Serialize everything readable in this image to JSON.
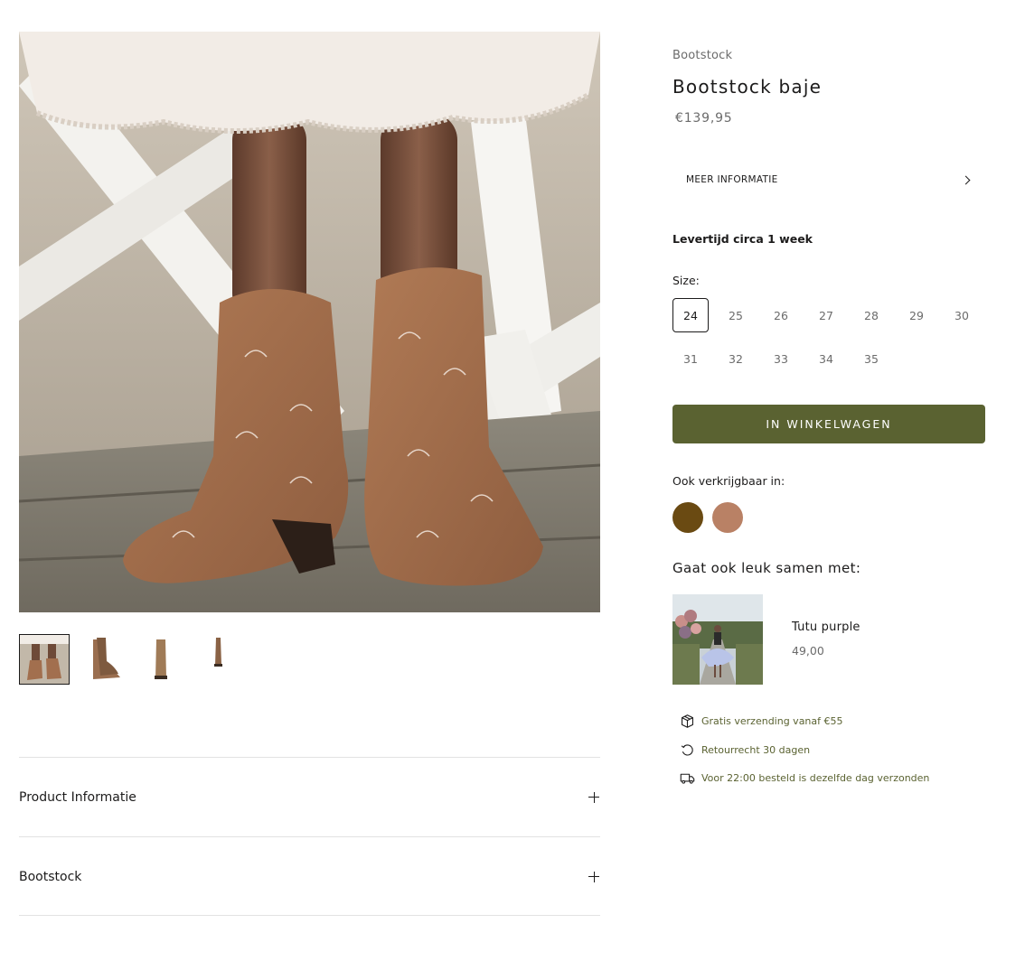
{
  "product": {
    "vendor": "Bootstock",
    "title": "Bootstock baje",
    "price": "€139,95",
    "more_info_label": "MEER INFORMATIE",
    "lead_time": "Levertijd circa 1 week",
    "size_label": "Size:",
    "sizes": [
      "24",
      "25",
      "26",
      "27",
      "28",
      "29",
      "30",
      "31",
      "32",
      "33",
      "34",
      "35"
    ],
    "selected_size": "24",
    "add_to_cart_label": "IN WINKELWAGEN",
    "also_available_label": "Ook verkrijgbaar in:",
    "swatch_colors": [
      "#6a4a12",
      "#b98165"
    ]
  },
  "pairing": {
    "heading": "Gaat ook leuk samen met:",
    "item_name": "Tutu purple",
    "item_price": "49,00"
  },
  "usps": [
    {
      "icon": "box-icon",
      "text": "Gratis verzending vanaf €55"
    },
    {
      "icon": "return-icon",
      "text": "Retourrecht 30 dagen"
    },
    {
      "icon": "truck-icon",
      "text": "Voor 22:00 besteld is dezelfde dag verzonden"
    }
  ],
  "accordions": [
    {
      "label": "Product Informatie"
    },
    {
      "label": "Bootstock"
    }
  ],
  "colors": {
    "accent": "#5a6231",
    "text": "#1c1b1b",
    "muted": "#6b6b6b"
  }
}
